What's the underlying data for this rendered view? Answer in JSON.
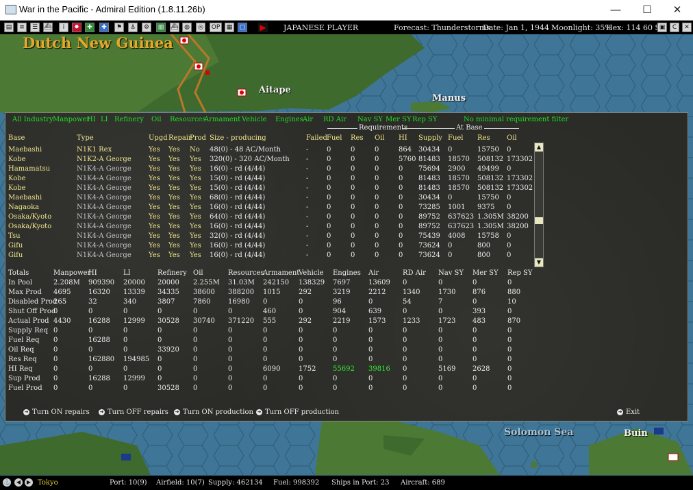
{
  "window": {
    "title": "War in the Pacific - Admiral Edition (1.8.11.26b)",
    "minimize": "—",
    "maximize": "☐",
    "close": "✕"
  },
  "toolbar": {
    "player": "JAPANESE PLAYER",
    "forecast": "Forecast: Thunderstorms",
    "date": "Date: Jan 1, 1944",
    "moonlight": "Moonlight: 35%",
    "hex": "Hex: 114 60 SL: 1",
    "op_button": "OP"
  },
  "map": {
    "region_title": "Dutch New Guinea",
    "labels": [
      "Aitape",
      "Manus",
      "Solomon Sea",
      "Buin"
    ]
  },
  "filters": [
    "All Industry",
    "Manpower",
    "HI",
    "LI",
    "Refinery",
    "Oil",
    "Resources",
    "Armament",
    "Vehicle",
    "Engines",
    "Air",
    "RD Air",
    "Nav SY",
    "Mer SY",
    "Rep SY",
    "No minimal requirement filter"
  ],
  "group_headers": {
    "requirements": "Requirements",
    "at_base": "At Base"
  },
  "columns": [
    "Base",
    "Type",
    "Upgd",
    "Repair",
    "Prod",
    "Size - producing",
    "Failed",
    "Fuel",
    "Res",
    "Oil",
    "HI",
    "Supply",
    "Fuel",
    "Res",
    "Oil"
  ],
  "rows": [
    [
      "Maebashi",
      "N1K1 Rex",
      "Yes",
      "Yes",
      "No",
      "48(0) - 48 AC/Month",
      "-",
      "0",
      "0",
      "0",
      "864",
      "30434",
      "0",
      "15750",
      "0"
    ],
    [
      "Kobe",
      "N1K2-A George",
      "Yes",
      "Yes",
      "Yes",
      "320(0) - 320 AC/Month",
      "-",
      "0",
      "0",
      "0",
      "5760",
      "81483",
      "18570",
      "508132",
      "173302"
    ],
    [
      "Hamamatsu",
      "N1K4-A George",
      "Yes",
      "Yes",
      "Yes",
      "16(0) - rd (4/44)",
      "-",
      "0",
      "0",
      "0",
      "0",
      "75694",
      "2900",
      "49499",
      "0"
    ],
    [
      "Kobe",
      "N1K4-A George",
      "Yes",
      "Yes",
      "Yes",
      "15(0) - rd (4/44)",
      "-",
      "0",
      "0",
      "0",
      "0",
      "81483",
      "18570",
      "508132",
      "173302"
    ],
    [
      "Kobe",
      "N1K4-A George",
      "Yes",
      "Yes",
      "Yes",
      "15(0) - rd (4/44)",
      "-",
      "0",
      "0",
      "0",
      "0",
      "81483",
      "18570",
      "508132",
      "173302"
    ],
    [
      "Maebashi",
      "N1K4-A George",
      "Yes",
      "Yes",
      "Yes",
      "68(0) - rd (4/44)",
      "-",
      "0",
      "0",
      "0",
      "0",
      "30434",
      "0",
      "15750",
      "0"
    ],
    [
      "Nagaoka",
      "N1K4-A George",
      "Yes",
      "Yes",
      "Yes",
      "16(0) - rd (4/44)",
      "-",
      "0",
      "0",
      "0",
      "0",
      "73285",
      "1001",
      "9375",
      "0"
    ],
    [
      "Osaka/Kyoto",
      "N1K4-A George",
      "Yes",
      "Yes",
      "Yes",
      "64(0) - rd (4/44)",
      "-",
      "0",
      "0",
      "0",
      "0",
      "89752",
      "637623",
      "1.305M",
      "38200"
    ],
    [
      "Osaka/Kyoto",
      "N1K4-A George",
      "Yes",
      "Yes",
      "Yes",
      "16(0) - rd (4/44)",
      "-",
      "0",
      "0",
      "0",
      "0",
      "89752",
      "637623",
      "1.305M",
      "38200"
    ],
    [
      "Tsu",
      "N1K4-A George",
      "Yes",
      "Yes",
      "Yes",
      "32(0) - rd (4/44)",
      "-",
      "0",
      "0",
      "0",
      "0",
      "75439",
      "4008",
      "15758",
      "0"
    ],
    [
      "Gifu",
      "N1K4-A George",
      "Yes",
      "Yes",
      "Yes",
      "16(0) - rd (4/44)",
      "-",
      "0",
      "0",
      "0",
      "0",
      "73624",
      "0",
      "800",
      "0"
    ],
    [
      "Gifu",
      "N1K4-A George",
      "Yes",
      "Yes",
      "Yes",
      "16(0) - rd (4/44)",
      "-",
      "0",
      "0",
      "0",
      "0",
      "73624",
      "0",
      "800",
      "0"
    ]
  ],
  "totals_columns": [
    "Totals",
    "Manpower",
    "HI",
    "LI",
    "Refinery",
    "Oil",
    "Resources",
    "Armament",
    "Vehicle",
    "Engines",
    "Air",
    "RD Air",
    "Nav SY",
    "Mer SY",
    "Rep SY"
  ],
  "totals_rows": [
    [
      "In Pool",
      "2.208M",
      "909390",
      "20000",
      "20000",
      "2.255M",
      "31.03M",
      "242150",
      "138329",
      "7697",
      "13609",
      "0",
      "0",
      "0",
      "0"
    ],
    [
      "Max Prod",
      "4695",
      "16320",
      "13339",
      "34335",
      "38600",
      "388200",
      "1015",
      "292",
      "3219",
      "2212",
      "1340",
      "1730",
      "876",
      "880"
    ],
    [
      "Disabled Prod",
      "265",
      "32",
      "340",
      "3807",
      "7860",
      "16980",
      "0",
      "0",
      "96",
      "0",
      "54",
      "7",
      "0",
      "10"
    ],
    [
      "Shut Off Prod",
      "0",
      "0",
      "0",
      "0",
      "0",
      "0",
      "460",
      "0",
      "904",
      "639",
      "0",
      "0",
      "393",
      "0"
    ],
    [
      "Actual Prod",
      "4430",
      "16288",
      "12999",
      "30528",
      "30740",
      "371220",
      "555",
      "292",
      "2219",
      "1573",
      "1233",
      "1723",
      "483",
      "870"
    ],
    [
      "Supply Req",
      "0",
      "0",
      "0",
      "0",
      "0",
      "0",
      "0",
      "0",
      "0",
      "0",
      "0",
      "0",
      "0",
      "0"
    ],
    [
      "Fuel Req",
      "0",
      "16288",
      "0",
      "0",
      "0",
      "0",
      "0",
      "0",
      "0",
      "0",
      "0",
      "0",
      "0",
      "0"
    ],
    [
      "Oil Req",
      "0",
      "0",
      "0",
      "33920",
      "0",
      "0",
      "0",
      "0",
      "0",
      "0",
      "0",
      "0",
      "0",
      "0"
    ],
    [
      "Res Req",
      "0",
      "162880",
      "194985",
      "0",
      "0",
      "0",
      "0",
      "0",
      "0",
      "0",
      "0",
      "0",
      "0",
      "0"
    ],
    [
      "HI Req",
      "0",
      "0",
      "0",
      "0",
      "0",
      "0",
      "6090",
      "1752",
      "55692",
      "39816",
      "0",
      "5169",
      "2628",
      "0"
    ],
    [
      "Sup Prod",
      "0",
      "16288",
      "12999",
      "0",
      "0",
      "0",
      "0",
      "0",
      "0",
      "0",
      "0",
      "0",
      "0",
      "0"
    ],
    [
      "Fuel Prod",
      "0",
      "0",
      "0",
      "30528",
      "0",
      "0",
      "0",
      "0",
      "0",
      "0",
      "0",
      "0",
      "0",
      "0"
    ]
  ],
  "actions": [
    "Turn ON repairs",
    "Turn OFF repairs",
    "Turn ON production",
    "Turn OFF production",
    "Exit"
  ],
  "status": {
    "location": "Tokyo",
    "port": "Port: 10(9)",
    "airfield": "Airfield: 10(7)",
    "supply": "Supply: 462134",
    "fuel": "Fuel: 998392",
    "ships": "Ships in Port: 23",
    "aircraft": "Aircraft: 689"
  },
  "colors": {
    "filter_green": "#22e022",
    "header_yellow": "#f0e68c",
    "highlight_green": "#33ee33",
    "map_title": "#e6a82a"
  }
}
